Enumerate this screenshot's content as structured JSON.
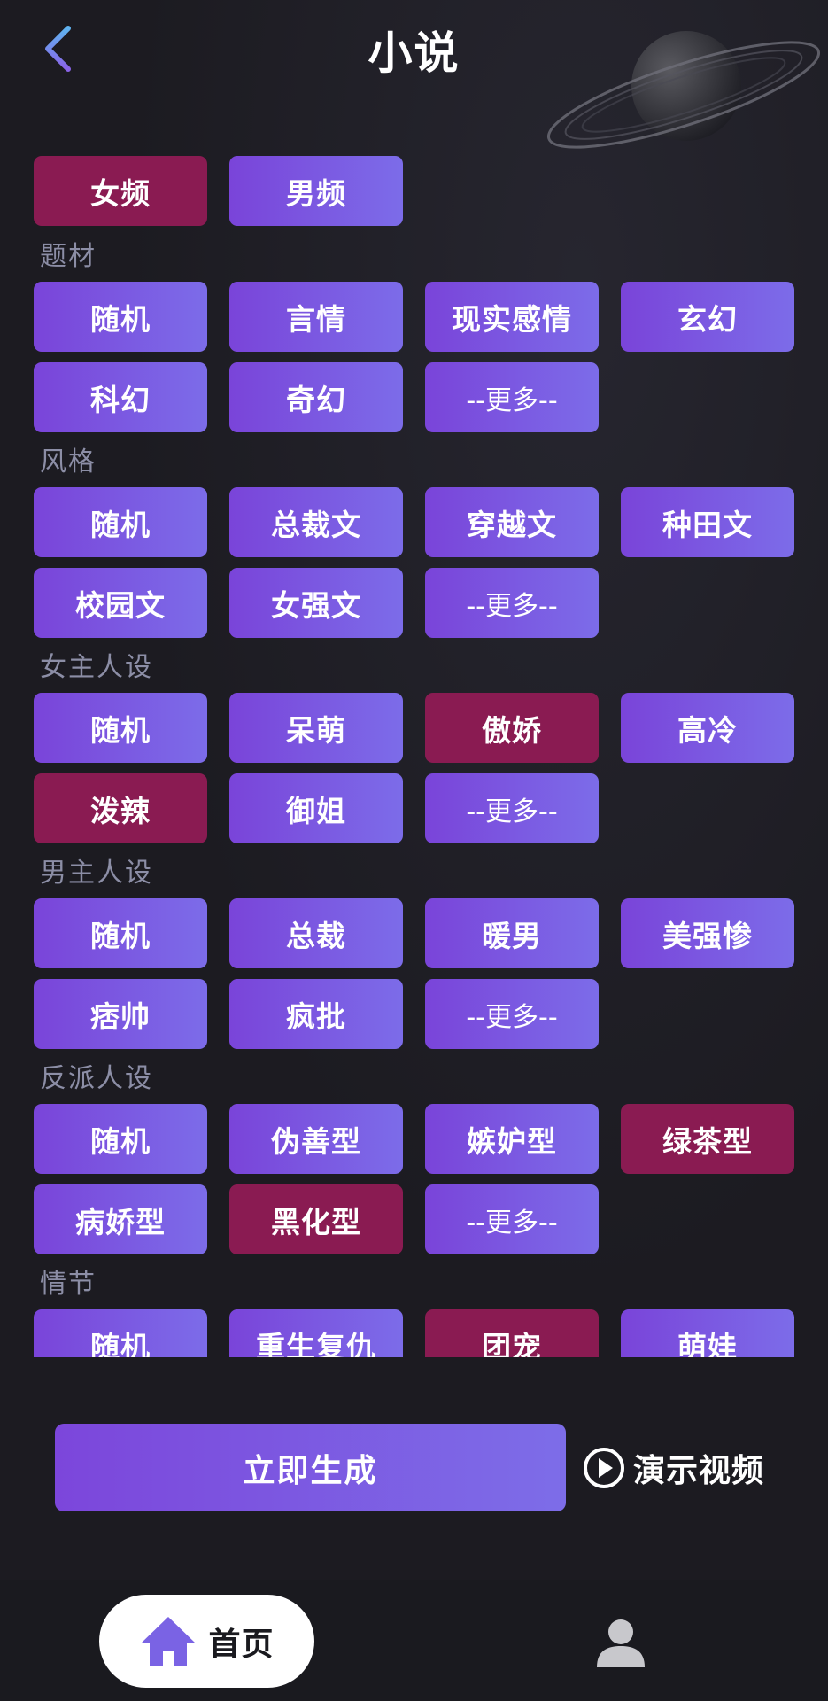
{
  "header": {
    "title": "小说"
  },
  "gender": {
    "options": [
      "女频",
      "男频"
    ]
  },
  "categories": [
    {
      "label": "题材",
      "rows": [
        [
          {
            "text": "随机"
          },
          {
            "text": "言情"
          },
          {
            "text": "现实感情"
          },
          {
            "text": "玄幻"
          }
        ],
        [
          {
            "text": "科幻"
          },
          {
            "text": "奇幻"
          },
          {
            "text": "--更多--"
          }
        ]
      ]
    },
    {
      "label": "风格",
      "rows": [
        [
          {
            "text": "随机"
          },
          {
            "text": "总裁文"
          },
          {
            "text": "穿越文"
          },
          {
            "text": "种田文"
          }
        ],
        [
          {
            "text": "校园文"
          },
          {
            "text": "女强文"
          },
          {
            "text": "--更多--"
          }
        ]
      ]
    },
    {
      "label": "女主人设",
      "rows": [
        [
          {
            "text": "随机"
          },
          {
            "text": "呆萌"
          },
          {
            "text": "傲娇",
            "selected": true
          },
          {
            "text": "高冷"
          }
        ],
        [
          {
            "text": "泼辣",
            "selected": true
          },
          {
            "text": "御姐"
          },
          {
            "text": "--更多--"
          }
        ]
      ]
    },
    {
      "label": "男主人设",
      "rows": [
        [
          {
            "text": "随机"
          },
          {
            "text": "总裁"
          },
          {
            "text": "暖男"
          },
          {
            "text": "美强惨"
          }
        ],
        [
          {
            "text": "痞帅"
          },
          {
            "text": "疯批"
          },
          {
            "text": "--更多--"
          }
        ]
      ]
    },
    {
      "label": "反派人设",
      "rows": [
        [
          {
            "text": "随机"
          },
          {
            "text": "伪善型"
          },
          {
            "text": "嫉妒型"
          },
          {
            "text": "绿茶型",
            "selected": true
          }
        ],
        [
          {
            "text": "病娇型"
          },
          {
            "text": "黑化型",
            "selected": true
          },
          {
            "text": "--更多--"
          }
        ]
      ]
    },
    {
      "label": "情节",
      "rows": [
        [
          {
            "text": "随机"
          },
          {
            "text": "重生复仇"
          },
          {
            "text": "团宠",
            "selected": true
          },
          {
            "text": "萌娃"
          }
        ]
      ]
    }
  ],
  "actions": {
    "generate_label": "立即生成",
    "demo_label": "演示视频"
  },
  "tabbar": {
    "home_label": "首页"
  },
  "colors": {
    "accent_start": "#7a44d9",
    "accent_end": "#7c6ce9",
    "selected": "#8a1b52",
    "background": "#1c1b21"
  },
  "icons": {
    "back": "chevron-left-icon",
    "play": "play-circle-icon",
    "home": "home-icon",
    "profile": "user-icon"
  }
}
